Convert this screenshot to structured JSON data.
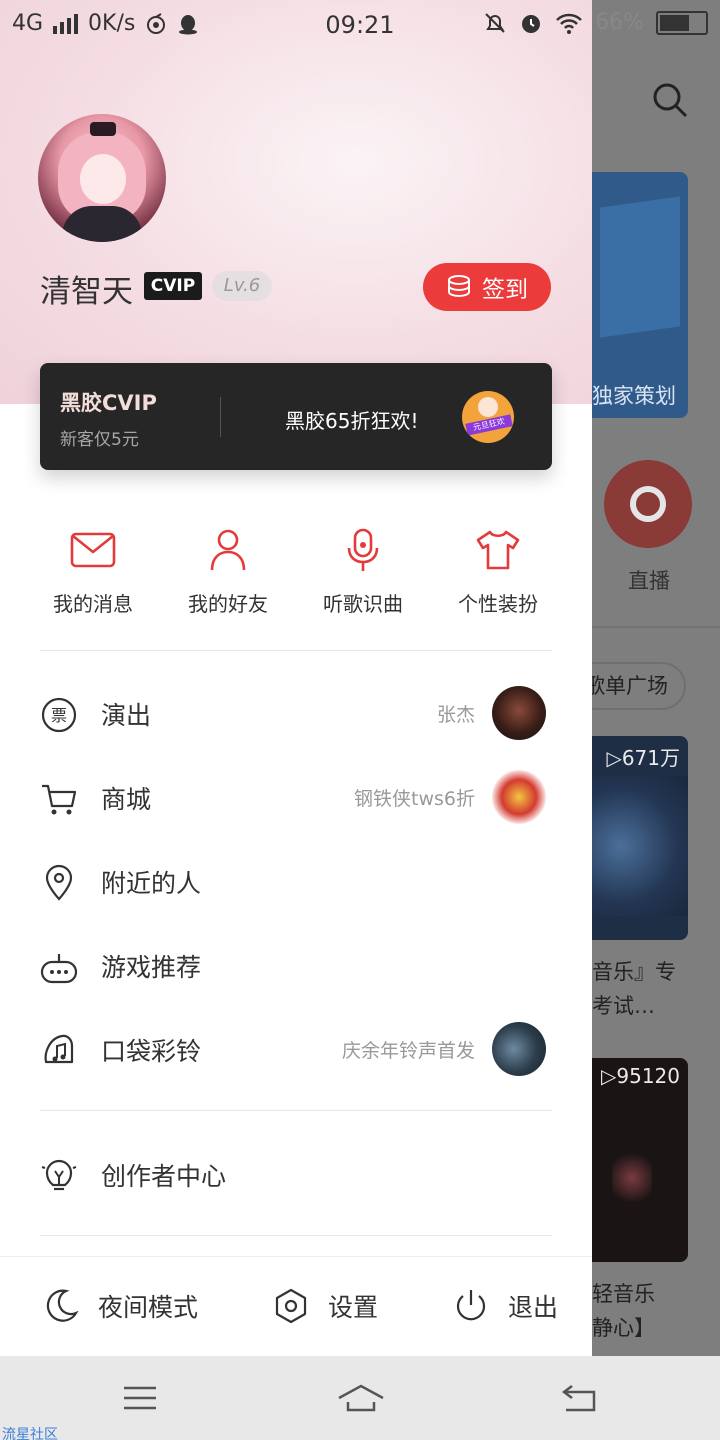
{
  "status_bar": {
    "network": "4G",
    "speed": "0K/s",
    "time": "09:21",
    "battery": "66%",
    "battery_level": 0.66
  },
  "profile": {
    "username": "清智天",
    "vip_badge": "CVIP",
    "level": "Lv.6",
    "checkin_label": "签到"
  },
  "vip_banner": {
    "brand": "黑胶CVIP",
    "subtitle": "新客仅5元",
    "promo": "黑胶65折狂欢!",
    "promo_tag": "元旦狂欢"
  },
  "quick_actions": [
    {
      "label": "我的消息",
      "icon": "envelope-icon"
    },
    {
      "label": "我的好友",
      "icon": "person-icon"
    },
    {
      "label": "听歌识曲",
      "icon": "microphone-icon"
    },
    {
      "label": "个性装扮",
      "icon": "tshirt-icon"
    }
  ],
  "menu": [
    {
      "label": "演出",
      "extra": "张杰",
      "icon": "ticket-icon"
    },
    {
      "label": "商城",
      "extra": "钢铁侠tws6折",
      "icon": "cart-icon"
    },
    {
      "label": "附近的人",
      "extra": "",
      "icon": "location-pin-icon"
    },
    {
      "label": "游戏推荐",
      "extra": "",
      "icon": "gamepad-icon"
    },
    {
      "label": "口袋彩铃",
      "extra": "庆余年铃声首发",
      "icon": "bell-note-icon"
    }
  ],
  "creator": {
    "label": "创作者中心",
    "icon": "lightbulb-icon"
  },
  "bottom_bar": {
    "night_mode": "夜间模式",
    "settings": "设置",
    "logout": "退出"
  },
  "background": {
    "card1_label": "独家策划",
    "live_label": "直播",
    "plaza_label": "歌单广场",
    "card2_count": "▷671万",
    "card2_text_a": "音乐』专",
    "card2_text_b": "考试…",
    "card3_count": "▷95120",
    "card3_text_a": "轻音乐",
    "card3_text_b": "静心】"
  },
  "watermark": "流星社区",
  "colors": {
    "accent": "#ec3b3b",
    "vip_banner_bg": "#262626",
    "hero_pink": "#f4dde3"
  }
}
